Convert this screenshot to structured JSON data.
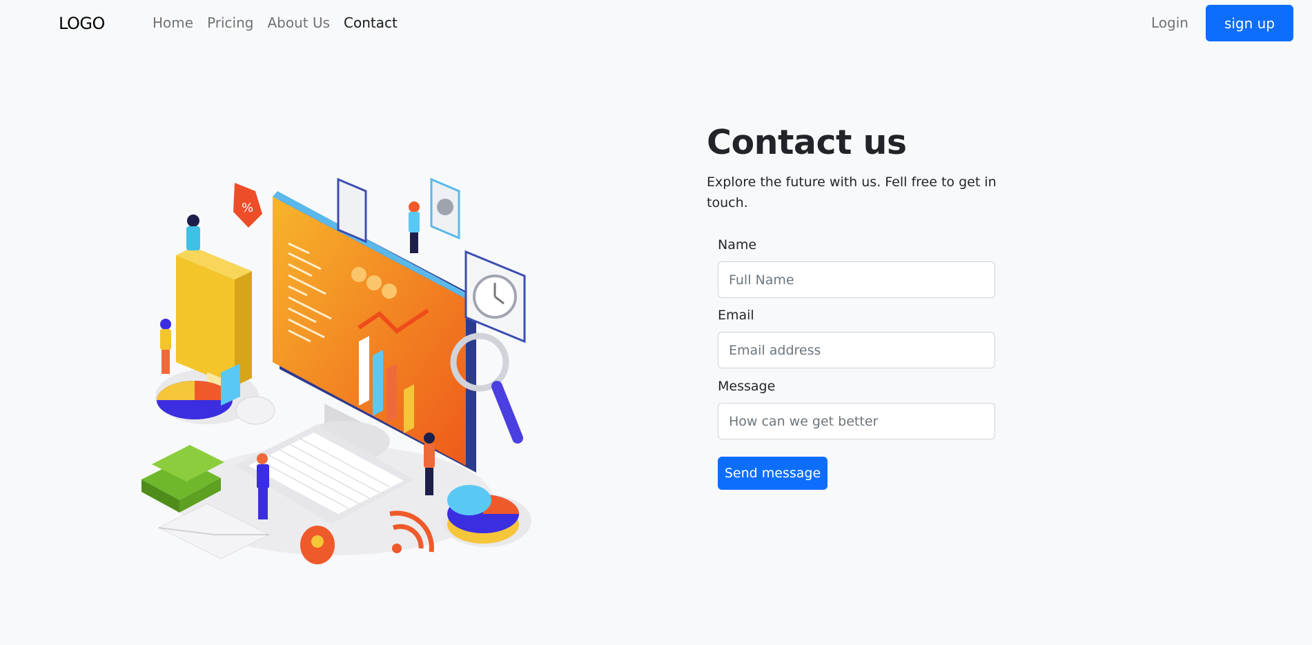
{
  "navbar": {
    "logo": "LOGO",
    "links": [
      {
        "label": "Home"
      },
      {
        "label": "Pricing"
      },
      {
        "label": "About Us"
      },
      {
        "label": "Contact"
      }
    ],
    "login_label": "Login",
    "signup_label": "sign up"
  },
  "hero": {
    "illustration": "isometric-business-analytics-illustration"
  },
  "contact": {
    "title": "Contact us",
    "subtitle": "Explore the future with us. Fell free to get in touch.",
    "fields": {
      "name": {
        "label": "Name",
        "placeholder": "Full Name",
        "value": ""
      },
      "email": {
        "label": "Email",
        "placeholder": "Email address",
        "value": ""
      },
      "message": {
        "label": "Message",
        "placeholder": "How can we get better",
        "value": ""
      }
    },
    "submit_label": "Send message"
  },
  "colors": {
    "primary": "#0d6efd",
    "background": "#f8f9fa",
    "text": "#212529"
  }
}
